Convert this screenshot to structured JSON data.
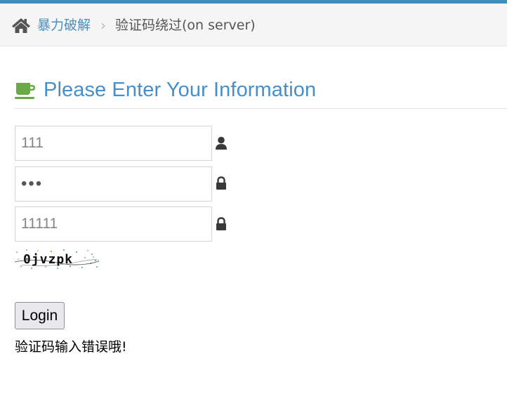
{
  "breadcrumb": {
    "parent_label": "暴力破解",
    "separator": "›",
    "current_label": "验证码绕过(on server)"
  },
  "header": {
    "title": "Please Enter Your Information"
  },
  "form": {
    "username_value": "111",
    "password_value": "•••",
    "captcha_value": "11111",
    "captcha_image_text": "0jvzpk",
    "login_label": "Login",
    "error_message": "验证码输入错误哦!"
  },
  "colors": {
    "top_stripe": "#438eb9",
    "link": "#4c8fbd",
    "title": "#478fca",
    "cup_icon": "#69aa46"
  },
  "icons": {
    "home": "home-icon",
    "title": "coffee-cup-icon",
    "username": "user-icon",
    "password": "lock-icon",
    "captcha": "lock-icon"
  }
}
